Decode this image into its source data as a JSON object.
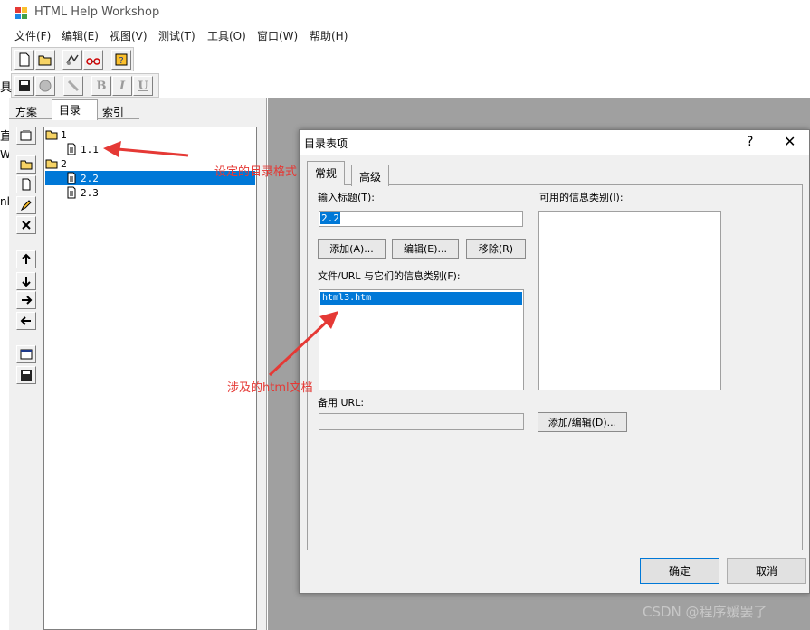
{
  "window": {
    "title": "HTML Help Workshop"
  },
  "menu": [
    {
      "label": "文件(F)"
    },
    {
      "label": "编辑(E)"
    },
    {
      "label": "视图(V)"
    },
    {
      "label": "测试(T)"
    },
    {
      "label": "工具(O)"
    },
    {
      "label": "窗口(W)"
    },
    {
      "label": "帮助(H)"
    }
  ],
  "format_toolbar": {
    "bold": "B",
    "italic": "I",
    "underline": "U"
  },
  "left_panel": {
    "tabs": [
      {
        "label": "方案"
      },
      {
        "label": "目录"
      },
      {
        "label": "索引"
      }
    ],
    "tree": [
      {
        "label": "1",
        "type": "folder"
      },
      {
        "label": "1.1",
        "type": "page"
      },
      {
        "label": "2",
        "type": "folder"
      },
      {
        "label": "2.2",
        "type": "page",
        "selected": true
      },
      {
        "label": "2.3",
        "type": "page"
      }
    ]
  },
  "partial_left_text": {
    "a": "具",
    "b": "直",
    "c": "W",
    "d": "nl"
  },
  "dialog": {
    "title": "目录表项",
    "help": "?",
    "close": "✕",
    "tabs": [
      {
        "label": "常规"
      },
      {
        "label": "高级"
      }
    ],
    "title_label": "输入标题(T):",
    "title_value": "2.2",
    "buttons": {
      "add": "添加(A)...",
      "edit": "编辑(E)...",
      "remove": "移除(R)"
    },
    "files_label": "文件/URL 与它们的信息类别(F):",
    "files": [
      "html3.htm"
    ],
    "alt_url_label": "备用 URL:",
    "alt_url_value": "",
    "info_types_label": "可用的信息类别(I):",
    "add_edit_button": "添加/编辑(D)...",
    "ok": "确定",
    "cancel": "取消"
  },
  "annotations": {
    "toc_format": "设定的目录格式",
    "html_doc": "涉及的html文档"
  },
  "watermark": "CSDN @程序媛罢了",
  "colors": {
    "selection": "#0078d7",
    "annotation": "#e53935",
    "mdi_bg": "#a0a0a0"
  }
}
